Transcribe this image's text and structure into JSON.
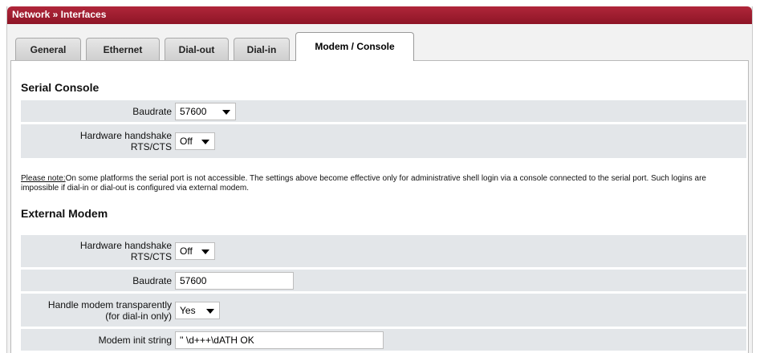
{
  "breadcrumb": "Network » Interfaces",
  "tabs": [
    {
      "label": "General"
    },
    {
      "label": "Ethernet"
    },
    {
      "label": "Dial-out"
    },
    {
      "label": "Dial-in"
    },
    {
      "label": "Modem / Console",
      "active": true
    }
  ],
  "serial_console": {
    "title": "Serial Console",
    "baudrate_label": "Baudrate",
    "baudrate_value": "57600",
    "handshake_label_line1": "Hardware handshake",
    "handshake_label_line2": "RTS/CTS",
    "handshake_value": "Off"
  },
  "note": {
    "label": "Please note:",
    "text": "On some platforms the serial port is not accessible. The settings above become effective only for administrative shell login via a console connected to the serial port. Such logins are impossible if dial-in or dial-out is configured via external modem."
  },
  "external_modem": {
    "title": "External Modem",
    "handshake_label_line1": "Hardware handshake",
    "handshake_label_line2": "RTS/CTS",
    "handshake_value": "Off",
    "baudrate_label": "Baudrate",
    "baudrate_value": "57600",
    "transparent_label_line1": "Handle modem transparently",
    "transparent_label_line2": "(for dial-in only)",
    "transparent_value": "Yes",
    "init_label": "Modem init string",
    "init_value": "'' \\d+++\\dATH OK"
  },
  "colors": {
    "titlebar": "#9e1c30",
    "row_background": "#e3e6e9"
  }
}
